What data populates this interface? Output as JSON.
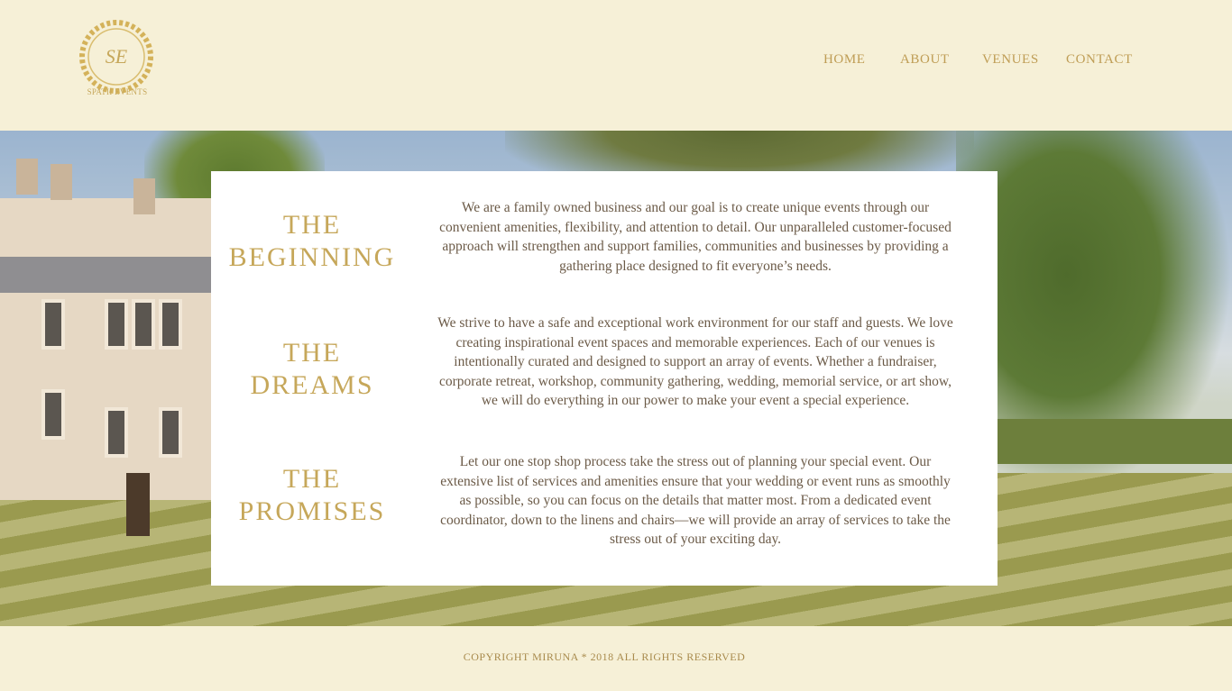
{
  "brand": {
    "monogram": "SE",
    "name": "SPATII EVENTS"
  },
  "nav": {
    "items": [
      {
        "label": "HOME"
      },
      {
        "label": "ABOUT"
      },
      {
        "label": "VENUES"
      },
      {
        "label": "CONTACT"
      }
    ]
  },
  "sections": [
    {
      "title_line1": "THE",
      "title_line2": "BEGINNING",
      "text": "We are a family owned business and our goal is to create unique events through our convenient amenities, flexibility, and attention to detail. Our unparalleled customer-focused approach will strengthen and support families, communities and businesses by providing a gathering place designed to fit everyone’s needs."
    },
    {
      "title_line1": "THE",
      "title_line2": "DREAMS",
      "text": "We strive to have a safe and exceptional work environment for our staff and guests. We love creating inspirational event spaces and memorable experiences.  Each of our venues is intentionally curated and designed to support an array of events.  Whether a fundraiser, corporate retreat, workshop, community gathering, wedding, memorial service, or art show, we will do everything in our power to make your event a special experience."
    },
    {
      "title_line1": "THE",
      "title_line2": "PROMISES",
      "text": "Let our one stop shop process take the stress out of planning your special event. Our extensive list of services and amenities ensure that your wedding or event runs as smoothly as possible, so you can focus on the details that matter most. From a dedicated event coordinator, down to the linens and chairs—we will provide an array of services to take the stress out of your exciting day."
    }
  ],
  "footer": {
    "copyright": "COPYRIGHT MIRUNA * 2018 ALL RIGHTS RESERVED"
  },
  "colors": {
    "background": "#f6f0d7",
    "gold": "#c6a75a",
    "body_text": "#6b5a47"
  }
}
